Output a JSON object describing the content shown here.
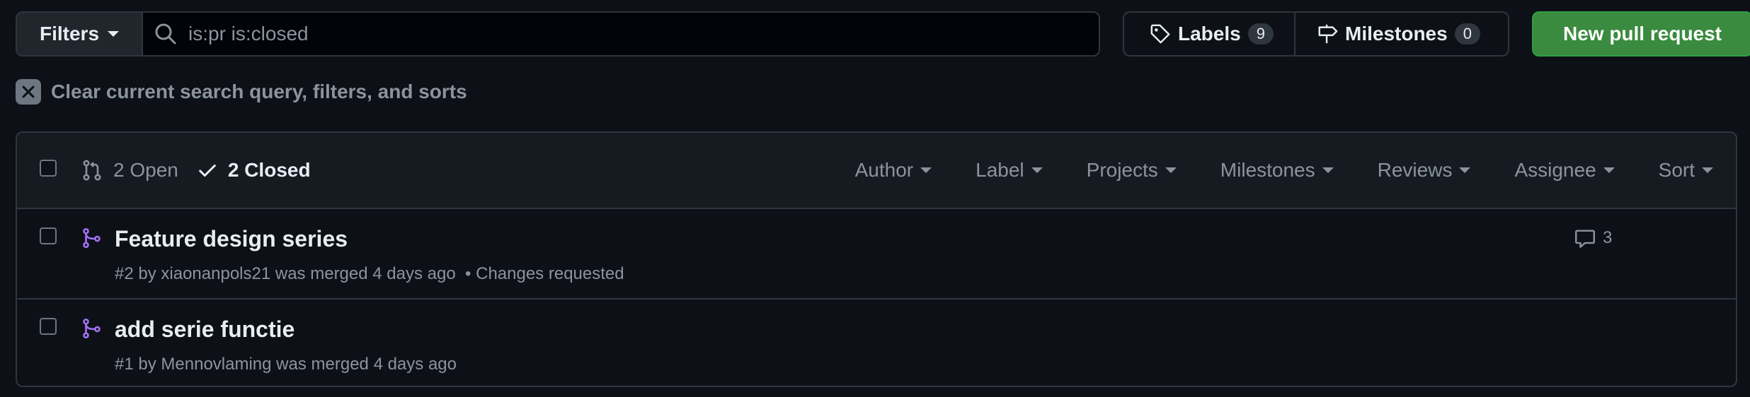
{
  "toolbar": {
    "filters_label": "Filters",
    "search_value": "is:pr is:closed",
    "labels_label": "Labels",
    "labels_count": "9",
    "milestones_label": "Milestones",
    "milestones_count": "0",
    "new_pr_label": "New pull request"
  },
  "clear_query_label": "Clear current search query, filters, and sorts",
  "list_header": {
    "open_label": "2 Open",
    "closed_label": "2 Closed",
    "filters": [
      "Author",
      "Label",
      "Projects",
      "Milestones",
      "Reviews",
      "Assignee",
      "Sort"
    ]
  },
  "pull_requests": [
    {
      "title": "Feature design series",
      "number": "#2",
      "by": "by",
      "author": "xiaonanpols21",
      "status": "was merged 4 days ago",
      "review": "Changes requested",
      "comments": "3"
    },
    {
      "title": "add serie functie",
      "number": "#1",
      "by": "by",
      "author": "Mennovlaming",
      "status": "was merged 4 days ago",
      "review": "",
      "comments": ""
    }
  ],
  "colors": {
    "background": "#0d1117",
    "header_bg": "#161b22",
    "border": "#30363d",
    "merged_purple": "#a371f7",
    "primary_green": "#3a8a3f",
    "muted_text": "#8b949e"
  }
}
